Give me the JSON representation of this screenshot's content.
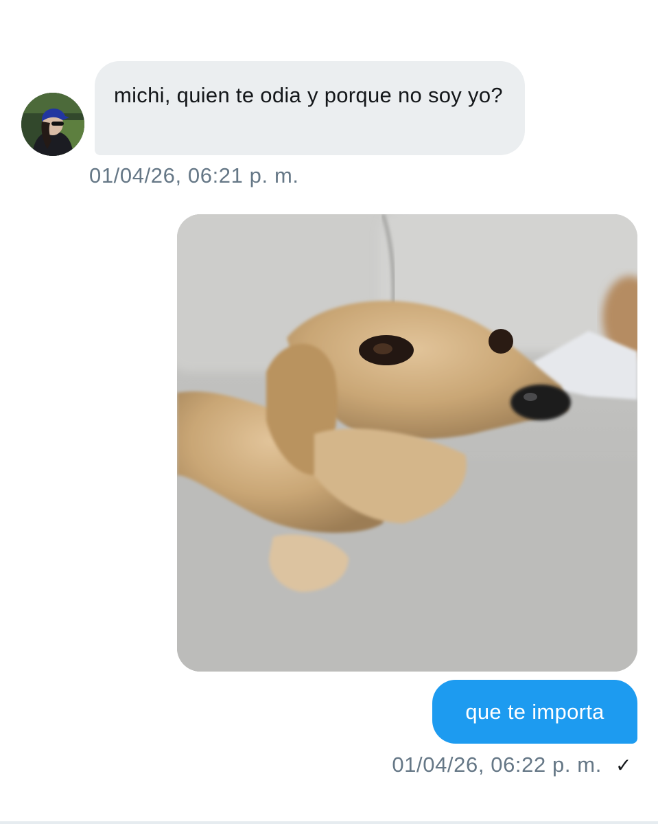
{
  "conversation": {
    "incoming": {
      "text": "michi, quien te odia y porque no soy yo?",
      "timestamp": "01/04/26, 06:21 p. m."
    },
    "outgoing_media": {
      "type": "image",
      "subject": "dog-photo"
    },
    "outgoing": {
      "text": "que te importa",
      "timestamp": "01/04/26, 06:22 p. m.",
      "status_icon": "check-icon",
      "status_glyph": "✓"
    }
  },
  "colors": {
    "incoming_bubble": "#ebeef0",
    "outgoing_bubble": "#1d9bf0",
    "timestamp": "#657786",
    "text": "#14171a"
  }
}
